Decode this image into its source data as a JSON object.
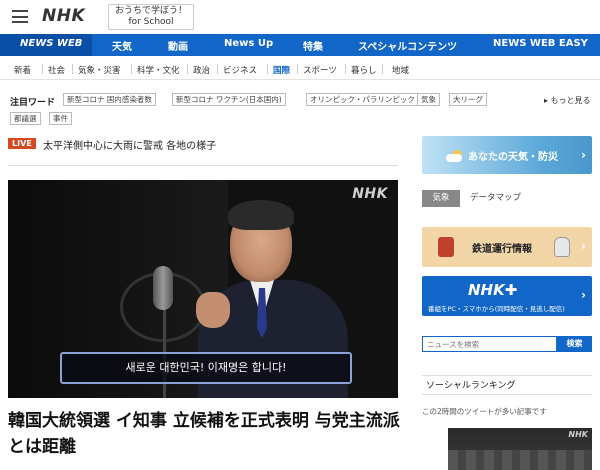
{
  "header": {
    "logo": "NHK",
    "school_line1": "おうちで学ぼう！",
    "school_line2": "for School"
  },
  "mainnav": {
    "newsweb": "NEWS WEB",
    "items": [
      "天気",
      "動画",
      "News Up",
      "特集",
      "スペシャルコンテンツ",
      "NEWS WEB EASY"
    ]
  },
  "categories": {
    "items": [
      "新着",
      "社会",
      "気象・災害",
      "科学・文化",
      "政治",
      "ビジネス",
      "国際",
      "スポーツ",
      "暮らし",
      "地域"
    ],
    "active": "国際"
  },
  "keywords": {
    "title": "注目ワード",
    "tags": [
      "新型コロナ 国内感染者数",
      "新型コロナ ワクチン(日本国内)",
      "オリンピック・パラリンピック",
      "気象",
      "大リーグ",
      "都議選",
      "事件"
    ],
    "more": "▸ もっと見る"
  },
  "live": {
    "badge": "LIVE",
    "text": "太平洋側中心に大雨に警戒 各地の様子"
  },
  "video": {
    "watermark": "NHK",
    "subtitle": "새로운 대한민국! 이재명은 합니다!"
  },
  "article": {
    "headline": "韓国大統領選 イ知事 立候補を正式表明 与党主流派とは距離"
  },
  "sidebar": {
    "weather_label": "あなたの天気・防災",
    "tab_active": "気象",
    "tab_other": "データマップ",
    "train_label": "鉄道運行情報",
    "plus_logo": "NHK✚",
    "plus_sub": "番組をPC・スマホから(同時配信・見逃し配信)",
    "search_placeholder": "ニュースを検索",
    "search_button": "検索",
    "social_title": "ソーシャルランキング",
    "social_sub": "この2時間のツイートが多い記事です",
    "thumb_watermark": "NHK"
  },
  "colors": {
    "brand_blue": "#1166c8",
    "live_red": "#d4491f"
  }
}
